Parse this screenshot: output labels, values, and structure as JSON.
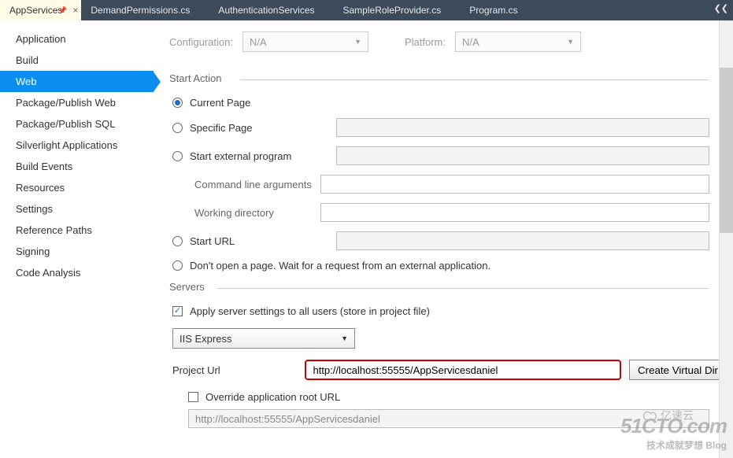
{
  "tabs": {
    "items": [
      {
        "label": "AppServices",
        "active": true,
        "pinned": true
      },
      {
        "label": "DemandPermissions.cs",
        "active": false
      },
      {
        "label": "AuthenticationServices",
        "active": false
      },
      {
        "label": "SampleRoleProvider.cs",
        "active": false
      },
      {
        "label": "Program.cs",
        "active": false
      }
    ]
  },
  "sidebar": {
    "items": [
      "Application",
      "Build",
      "Web",
      "Package/Publish Web",
      "Package/Publish SQL",
      "Silverlight Applications",
      "Build Events",
      "Resources",
      "Settings",
      "Reference Paths",
      "Signing",
      "Code Analysis"
    ],
    "selected_index": 2
  },
  "config": {
    "configuration_label": "Configuration:",
    "configuration_value": "N/A",
    "platform_label": "Platform:",
    "platform_value": "N/A"
  },
  "start_action": {
    "heading": "Start Action",
    "options": {
      "current_page": "Current Page",
      "specific_page": "Specific Page",
      "start_external": "Start external program",
      "cmdline_label": "Command line arguments",
      "workdir_label": "Working directory",
      "start_url": "Start URL",
      "dont_open": "Don't open a page.  Wait for a request from an external application."
    },
    "selected": "current_page"
  },
  "servers": {
    "heading": "Servers",
    "apply_label": "Apply server settings to all users (store in project file)",
    "apply_checked": true,
    "server_type": "IIS Express",
    "project_url_label": "Project Url",
    "project_url_value": "http://localhost:55555/AppServicesdaniel",
    "create_vdir_label": "Create Virtual Dir",
    "override_label": "Override application root URL",
    "override_checked": false,
    "override_value": "http://localhost:55555/AppServicesdaniel"
  },
  "watermark": {
    "line1": "51CTO.com",
    "line2": "技术成就梦想    Blog",
    "yisu": "亿速云"
  }
}
